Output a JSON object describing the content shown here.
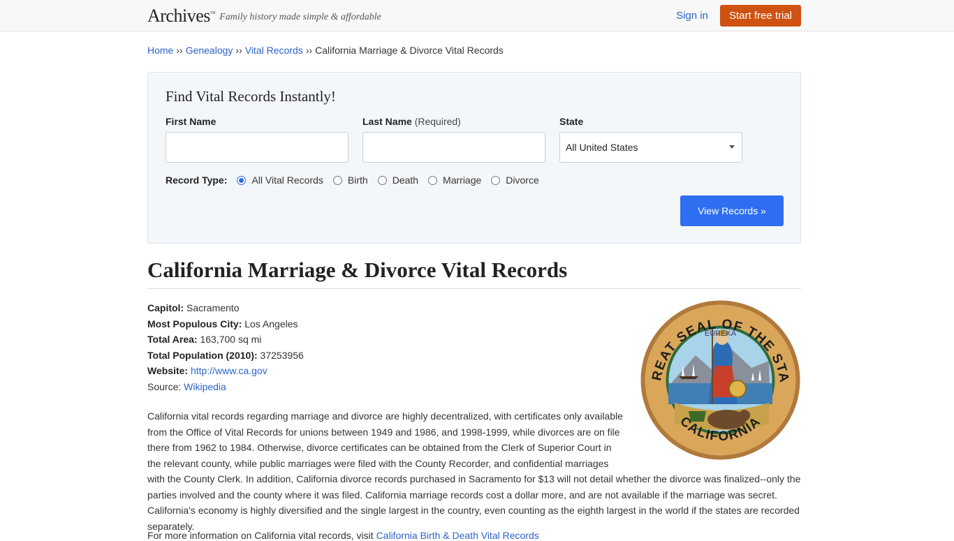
{
  "header": {
    "logo": "Archives",
    "logo_tm": "™",
    "tagline": "Family history made simple & affordable",
    "sign_in": "Sign in",
    "start_trial": "Start free trial"
  },
  "breadcrumb": {
    "items": [
      "Home",
      "Genealogy",
      "Vital Records"
    ],
    "separator": "››",
    "current": "California Marriage & Divorce Vital Records"
  },
  "search": {
    "title": "Find Vital Records Instantly!",
    "first_name_label": "First Name",
    "last_name_label": "Last Name",
    "last_name_req": "(Required)",
    "state_label": "State",
    "state_value": "All United States",
    "record_type_label": "Record Type:",
    "record_types": [
      "All Vital Records",
      "Birth",
      "Death",
      "Marriage",
      "Divorce"
    ],
    "selected_record_type": "All Vital Records",
    "submit": "View Records »"
  },
  "page_title": "California Marriage & Divorce Vital Records",
  "facts": {
    "capitol_label": "Capitol:",
    "capitol": "Sacramento",
    "city_label": "Most Populous City:",
    "city": "Los Angeles",
    "area_label": "Total Area:",
    "area": "163,700 sq mi",
    "population_label": "Total Population (2010):",
    "population": "37253956",
    "website_label": "Website:",
    "website": "http://www.ca.gov",
    "source_label": "Source:",
    "source": "Wikipedia"
  },
  "seal": {
    "top_text": "THE GREAT SEAL OF THE STATE OF",
    "bottom_text": "CALIFORNIA",
    "motto": "EUREKA"
  },
  "body": "California vital records regarding marriage and divorce are highly decentralized, with certificates only available from the Office of Vital Records for unions between 1949 and 1986, and 1998-1999, while divorces are on file there from 1962 to 1984. Otherwise, divorce certificates can be obtained from the Clerk of Superior Court in the relevant county, while public marriages were filed with the County Recorder, and confidential marriages with the County Clerk. In addition, California divorce records purchased in Sacramento for $13 will not detail whether the divorce was finalized--only the parties involved and the county where it was filed. California marriage records cost a dollar more, and are not available if the marriage was secret. California's economy is highly diversified and the single largest in the country, even counting as the eighth largest in the world if the states are recorded separately.",
  "more_info": {
    "text": "For more information on California vital records, visit",
    "link": "California Birth & Death Vital Records"
  },
  "colors": {
    "accent_orange": "#cf5213",
    "accent_blue": "#2e6ef0",
    "link": "#2b63c9"
  }
}
